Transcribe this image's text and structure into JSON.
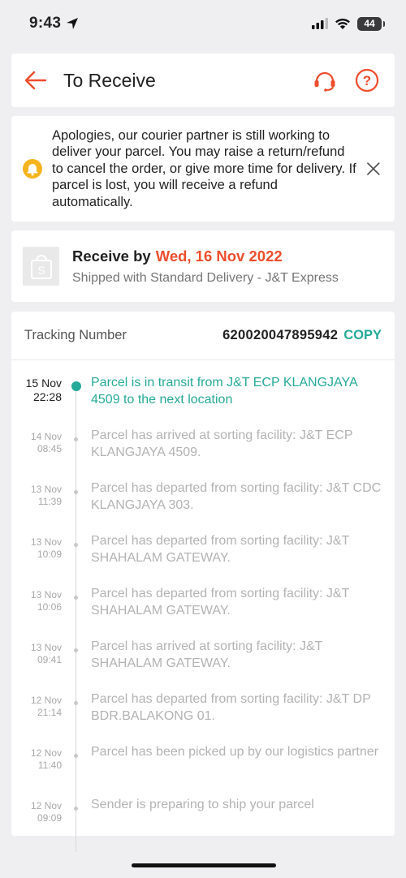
{
  "status_bar": {
    "time": "9:43",
    "battery": "44"
  },
  "header": {
    "title": "To Receive"
  },
  "notice": {
    "message": "Apologies, our courier partner is still working to deliver your parcel. You may raise a return/refund to cancel the order, or give more time for delivery. If parcel is lost, you will receive a refund automatically."
  },
  "receive": {
    "prefix": "Receive by",
    "date": "Wed, 16 Nov 2022",
    "shipping": "Shipped with Standard Delivery - J&T Express"
  },
  "tracking": {
    "label": "Tracking Number",
    "number": "620020047895942",
    "copy_label": "COPY",
    "events": [
      {
        "date": "15 Nov",
        "time": "22:28",
        "text": "Parcel is in transit from J&T ECP KLANGJAYA 4509 to the next location",
        "active": true
      },
      {
        "date": "14 Nov",
        "time": "08:45",
        "text": "Parcel has arrived at sorting facility: J&T ECP KLANGJAYA 4509."
      },
      {
        "date": "13 Nov",
        "time": "11:39",
        "text": "Parcel has departed from sorting facility: J&T CDC KLANGJAYA 303."
      },
      {
        "date": "13 Nov",
        "time": "10:09",
        "text": "Parcel has departed from sorting facility: J&T SHAHALAM GATEWAY."
      },
      {
        "date": "13 Nov",
        "time": "10:06",
        "text": "Parcel has departed from sorting facility: J&T SHAHALAM GATEWAY."
      },
      {
        "date": "13 Nov",
        "time": "09:41",
        "text": "Parcel has arrived at sorting facility: J&T SHAHALAM GATEWAY."
      },
      {
        "date": "12 Nov",
        "time": "21:14",
        "text": "Parcel has departed from sorting facility: J&T DP BDR.BALAKONG 01."
      },
      {
        "date": "12 Nov",
        "time": "11:40",
        "text": "Parcel has been picked up by our logistics partner"
      },
      {
        "date": "12 Nov",
        "time": "09:09",
        "text": "Sender is preparing to ship your parcel"
      }
    ]
  },
  "colors": {
    "accent": "#ee4d2d",
    "teal": "#26aa99",
    "bell": "#f6b41e"
  },
  "icons": [
    "back-arrow-icon",
    "headset-icon",
    "help-icon",
    "bell-icon",
    "close-icon",
    "shop-bag-icon",
    "location-arrow-icon",
    "signal-icon",
    "wifi-icon",
    "battery-icon"
  ]
}
